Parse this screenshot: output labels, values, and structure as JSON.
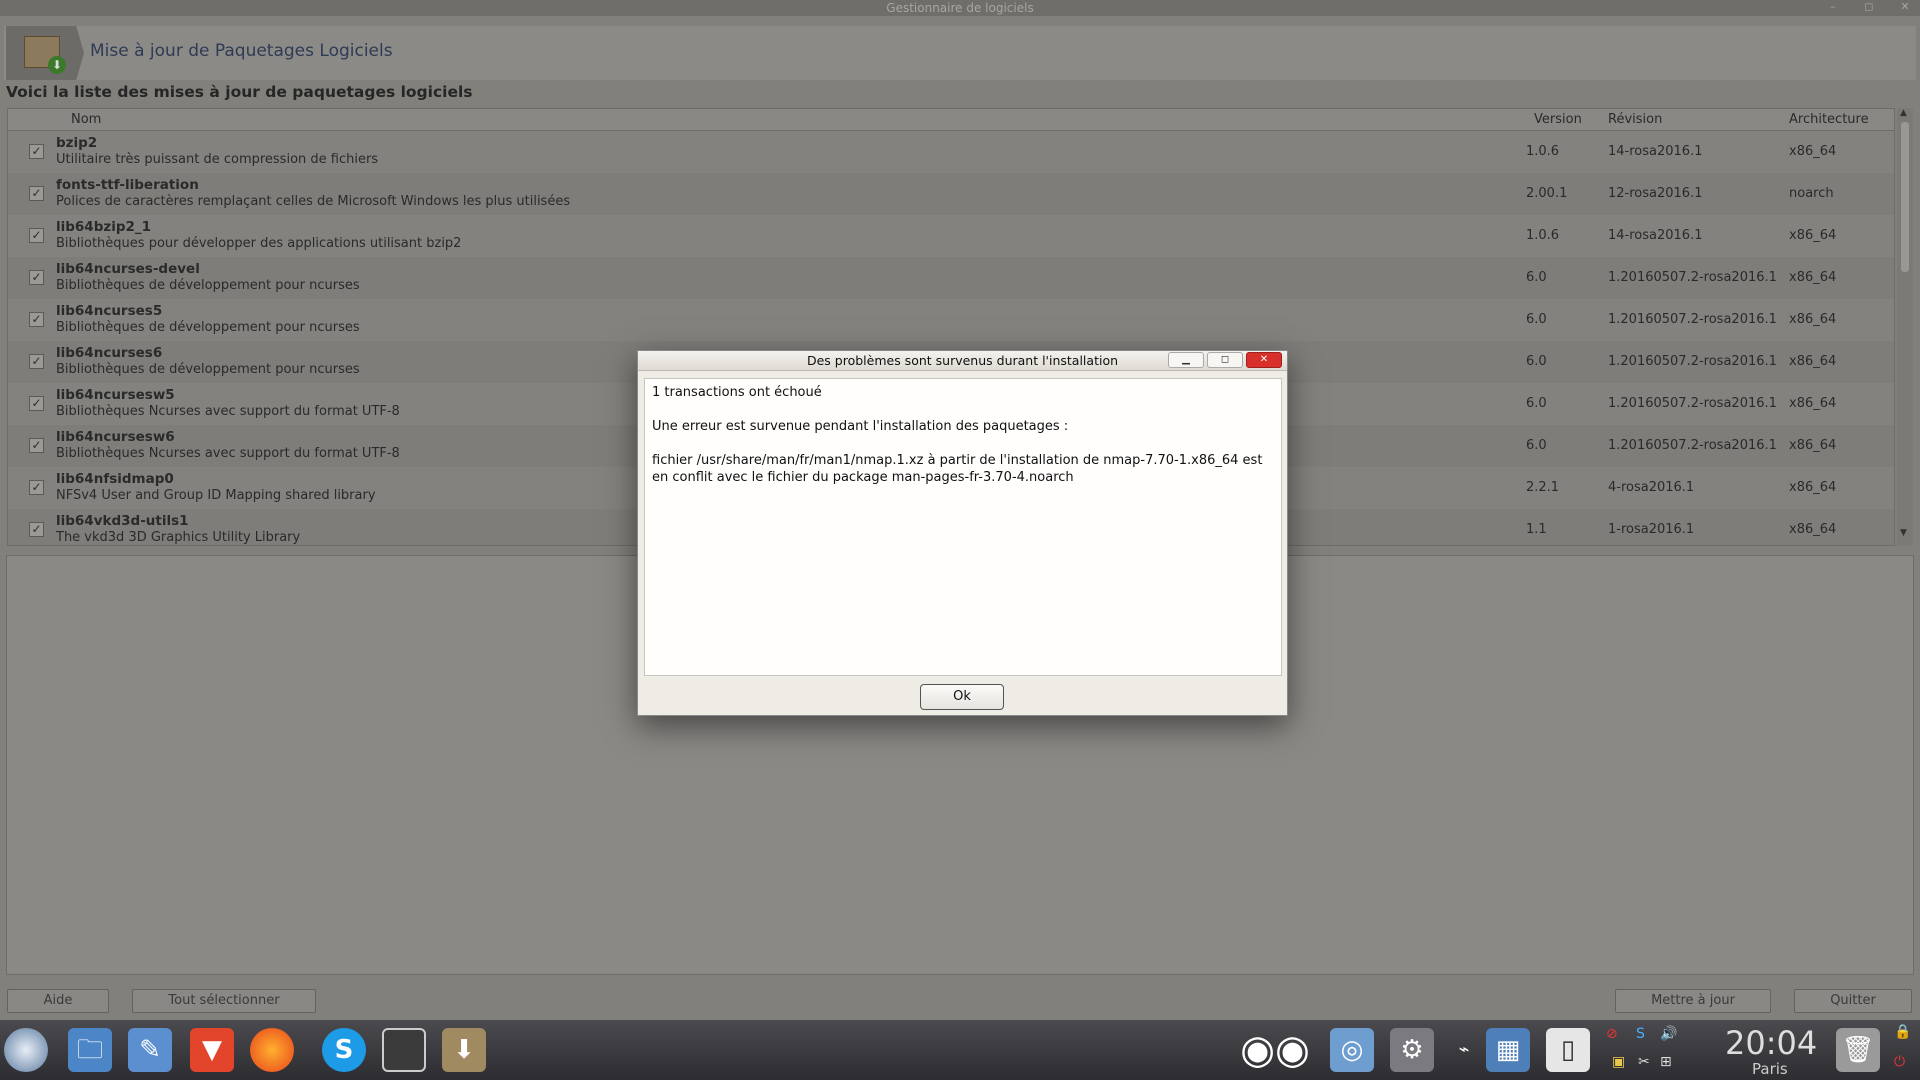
{
  "window": {
    "title": "Gestionnaire de logiciels",
    "controls": {
      "minimize": "–",
      "maximize": "◻",
      "close": "✕"
    }
  },
  "banner": {
    "title": "Mise à jour de Paquetages Logiciels",
    "icon": "package-update-icon"
  },
  "heading": "Voici la liste des mises à jour de paquetages logiciels",
  "table": {
    "columns": {
      "name": "Nom",
      "version": "Version",
      "revision": "Révision",
      "arch": "Architecture"
    },
    "rows": [
      {
        "name": "bzip2",
        "desc": "Utilitaire très puissant de compression de fichiers",
        "version": "1.0.6",
        "revision": "14-rosa2016.1",
        "arch": "x86_64"
      },
      {
        "name": "fonts-ttf-liberation",
        "desc": "Polices de caractères remplaçant celles de Microsoft Windows les plus utilisées",
        "version": "2.00.1",
        "revision": "12-rosa2016.1",
        "arch": "noarch"
      },
      {
        "name": "lib64bzip2_1",
        "desc": "Bibliothèques pour développer des applications utilisant bzip2",
        "version": "1.0.6",
        "revision": "14-rosa2016.1",
        "arch": "x86_64"
      },
      {
        "name": "lib64ncurses-devel",
        "desc": "Bibliothèques de développement pour ncurses",
        "version": "6.0",
        "revision": "1.20160507.2-rosa2016.1",
        "arch": "x86_64"
      },
      {
        "name": "lib64ncurses5",
        "desc": "Bibliothèques de développement pour ncurses",
        "version": "6.0",
        "revision": "1.20160507.2-rosa2016.1",
        "arch": "x86_64"
      },
      {
        "name": "lib64ncurses6",
        "desc": "Bibliothèques de développement pour ncurses",
        "version": "6.0",
        "revision": "1.20160507.2-rosa2016.1",
        "arch": "x86_64"
      },
      {
        "name": "lib64ncursesw5",
        "desc": "Bibliothèques Ncurses avec support du format UTF-8",
        "version": "6.0",
        "revision": "1.20160507.2-rosa2016.1",
        "arch": "x86_64"
      },
      {
        "name": "lib64ncursesw6",
        "desc": "Bibliothèques Ncurses avec support du format UTF-8",
        "version": "6.0",
        "revision": "1.20160507.2-rosa2016.1",
        "arch": "x86_64"
      },
      {
        "name": "lib64nfsidmap0",
        "desc": "NFSv4 User and Group ID Mapping shared library",
        "version": "2.2.1",
        "revision": "4-rosa2016.1",
        "arch": "x86_64"
      },
      {
        "name": "lib64vkd3d-utils1",
        "desc": "The vkd3d 3D Graphics Utility Library",
        "version": "1.1",
        "revision": "1-rosa2016.1",
        "arch": "x86_64"
      }
    ]
  },
  "buttons": {
    "help": "Aide",
    "select_all": "Tout sélectionner",
    "update": "Mettre à jour",
    "quit": "Quitter"
  },
  "dialog": {
    "title": "Des problèmes sont survenus durant l'installation",
    "line1": "1 transactions ont échoué",
    "line2": "Une erreur est survenue pendant l'installation des paquetages :",
    "line3": "fichier /usr/share/man/fr/man1/nmap.1.xz à partir de l'installation de nmap-7.70-1.x86_64 est en conflit avec le fichier du package man-pages-fr-3.70-4.noarch",
    "ok": "Ok"
  },
  "taskbar": {
    "clock": "20:04",
    "location": "Paris"
  },
  "colors": {
    "accent_close": "#d8302b",
    "banner_title": "#2e3b55"
  }
}
